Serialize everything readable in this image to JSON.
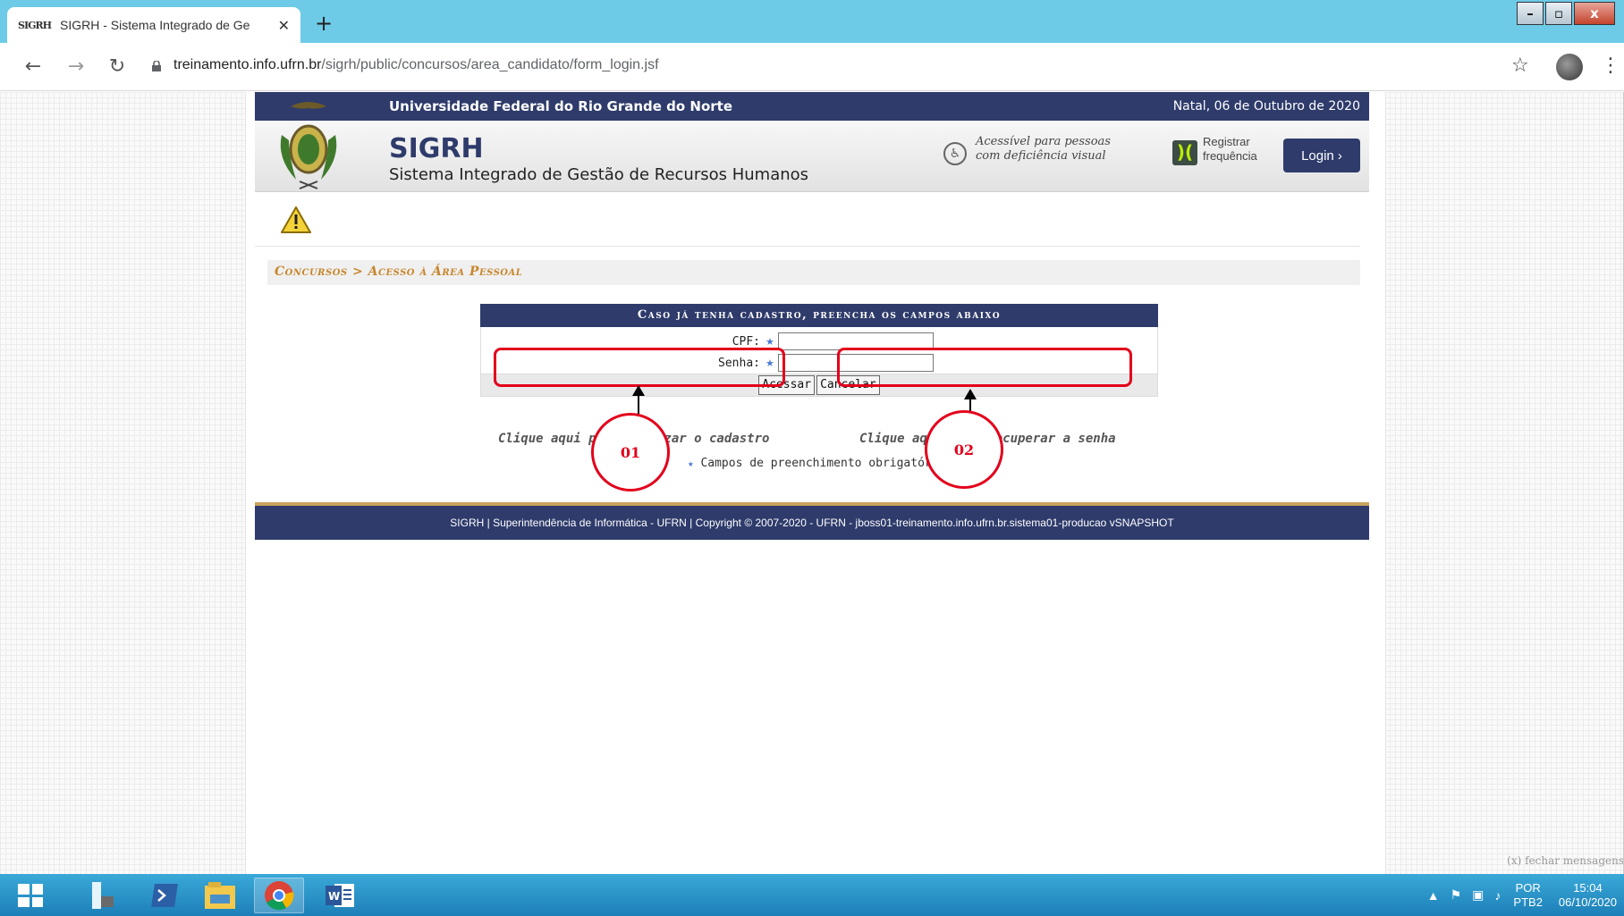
{
  "browser": {
    "tab_title": "SIGRH - Sistema Integrado de Ge",
    "tab_favicon": "SIGRH",
    "url_host": "treinamento.info.ufrn.br",
    "url_path": "/sigrh/public/concursos/area_candidato/form_login.jsf",
    "icons": [
      "back-arrow-icon",
      "forward-arrow-icon",
      "reload-icon",
      "lock-icon",
      "star-icon",
      "profile-icon",
      "menu-icon"
    ]
  },
  "window_controls": {
    "minimize": "–",
    "maximize": "▫",
    "close": "x"
  },
  "header": {
    "university": "Universidade Federal do Rio Grande do Norte",
    "date": "Natal, 06 de Outubro de 2020",
    "app_title": "SIGRH",
    "app_subtitle": "Sistema Integrado de Gestão de Recursos Humanos",
    "accessibility_line1": "Acessível para pessoas",
    "accessibility_line2": "com deficiência visual",
    "register_line1": "Registrar",
    "register_line2": "frequência",
    "login_label": "Login  ›"
  },
  "breadcrumb": "Concursos > Acesso à Área Pessoal",
  "form": {
    "caption": "Caso já tenha cadastro, preencha os campos abaixo",
    "cpf_label": "CPF:",
    "cpf_value": "",
    "senha_label": "Senha:",
    "senha_value": "",
    "submit_label": "Acessar",
    "cancel_label": "Cancelar"
  },
  "links": {
    "cadastro": "Clique aqui para realizar o cadastro",
    "recuperar_senha": "Clique aqui para recuperar a senha"
  },
  "required_note": "Campos de preenchimento obrigatório.",
  "footer_text": "SIGRH | Superintendência de Informática - UFRN | Copyright © 2007-2020 - UFRN - jboss01-treinamento.info.ufrn.br.sistema01-producao vSNAPSHOT",
  "annotations": {
    "first": "01",
    "second": "02",
    "color": "#e3001b"
  },
  "fechar_msg": "(x) fechar mensagens",
  "taskbar": {
    "apps": [
      "windows-start-icon",
      "server-manager-icon",
      "powershell-icon",
      "file-explorer-icon",
      "chrome-icon",
      "word-icon"
    ],
    "lang_top": "POR",
    "lang_bottom": "PTB2",
    "time": "15:04",
    "date": "06/10/2020"
  },
  "colors": {
    "brand_navy": "#2e3b6b",
    "breadcrumb_orange": "#c8862c",
    "footer_gold": "#c8a35e"
  }
}
